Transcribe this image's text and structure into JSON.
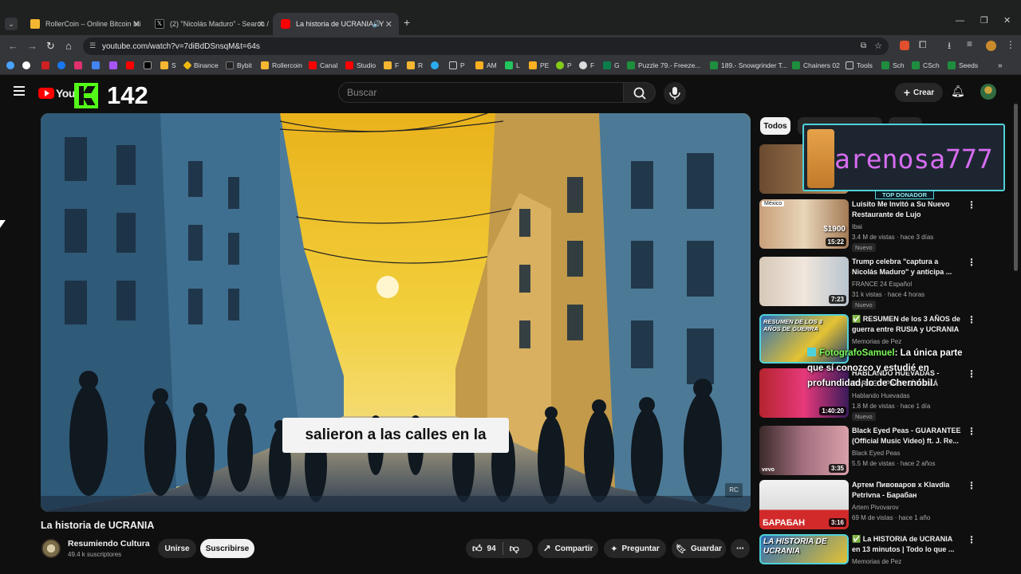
{
  "browser": {
    "tabs": [
      {
        "title": "RollerCoin – Online Bitcoin Mi",
        "color": "#f5b731"
      },
      {
        "title": "(2) \"Nicolás Maduro\" - Search /",
        "color": "#ffffff"
      },
      {
        "title": "La historia de UCRANIA - Y",
        "color": "#ff0000"
      }
    ],
    "url": "youtube.com/watch?v=7diBdDSnsqM&t=64s",
    "bookmarks": [
      "S",
      "Binance",
      "Bybit",
      "Rollercoin",
      "Canal",
      "Studio",
      "F",
      "R",
      "P",
      "AM",
      "L",
      "PE",
      "P",
      "F",
      "G",
      "Puzzle 79.- Freeze...",
      "189.- Snowgrinder T...",
      "Chainers 02",
      "Tools",
      "Sch",
      "CSch",
      "Seeds"
    ]
  },
  "yt": {
    "logo_text": "YouTu",
    "overlay_number": "142",
    "search_placeholder": "Buscar",
    "create_label": "Crear"
  },
  "video": {
    "subtitle": "salieron a las calles en la",
    "watermark": "RC",
    "title": "La historia de UCRANIA",
    "channel": "Resumiendo Cultura",
    "subs": "49.4 k suscriptores",
    "join": "Unirse",
    "subscribe": "Suscribirse",
    "likes": "94",
    "share": "Compartir",
    "ask": "Preguntar",
    "save": "Guardar"
  },
  "chips": [
    "Todos"
  ],
  "overlay": {
    "donor_name": "arenosa777",
    "donor_label": "TOP DONADOR",
    "chat_user": "FotografoSamuel",
    "chat_lines": [
      ": La única parte",
      "que sí conozco y estudié en",
      "profundidad, lo de Chernóbil."
    ]
  },
  "related": [
    {
      "title1": "Luisito Me Invitó a Su Nuevo",
      "title2": "Restaurante de Lujo",
      "channel": "Ibai",
      "meta": "3.4 M de vistas · hace 3 días",
      "duration": "15:22",
      "badge": "Nuevo",
      "thumb_label": "México",
      "thumb_price": "$1900"
    },
    {
      "title1": "Trump celebra \"captura a",
      "title2": "Nicolás Maduro\" y anticipa ...",
      "channel": "FRANCE 24 Español",
      "meta": "31 k vistas · hace 4 horas",
      "duration": "7:23",
      "badge": "Nuevo"
    },
    {
      "title1": "✅ RESUMEN de los 3 AÑOS de",
      "title2": "guerra entre RUSIA y UCRANIA",
      "channel": "Memorias de Pez",
      "meta": "",
      "duration": "",
      "thumb_label": "RESUMEN DE LOS 3 AÑOS DE GUERRA"
    },
    {
      "title1": "HABLANDO HUEVADAS -",
      "title2": "JORGE Y PARA SÍ MAMÁ",
      "channel": "Hablando Huevadas",
      "meta": "1.8 M de vistas · hace 1 día",
      "duration": "1:40:20",
      "badge": "Nuevo"
    },
    {
      "title1": "Black Eyed Peas - GUARANTEE",
      "title2": "(Official Music Video) ft. J. Re...",
      "channel": "Black Eyed Peas",
      "meta": "5.5 M de vistas · hace 2 años",
      "duration": "3:35",
      "thumb_label": "vevo"
    },
    {
      "title1": "Артем Пивоваров x Klavdia",
      "title2": "Petrivna - Барабан",
      "channel": "Artem Pivovarov",
      "meta": "69 M de vistas · hace 1 año",
      "duration": "3:16",
      "thumb_label": "БАРАБАН"
    },
    {
      "title1": "✅ La HISTORIA de UCRANIA",
      "title2": "en 13 minutos | Todo lo que ...",
      "channel": "Memorias de Pez",
      "meta": "",
      "duration": "",
      "thumb_label": "LA HISTORIA DE UCRANIA"
    }
  ],
  "colors": {
    "accent": "#ff0000",
    "overlay_cyan": "#4fd1d9",
    "overlay_magenta": "#d56cf0",
    "kick_green": "#53fc18"
  }
}
